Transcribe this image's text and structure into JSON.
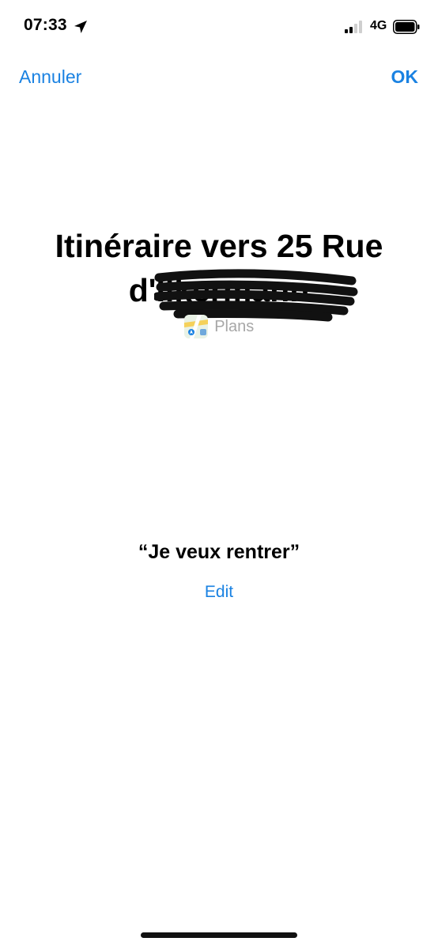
{
  "status_bar": {
    "time": "07:33",
    "network": "4G",
    "icons": [
      "location-arrow-icon",
      "signal-bars-icon",
      "battery-icon"
    ]
  },
  "nav": {
    "cancel_label": "Annuler",
    "ok_label": "OK"
  },
  "title": {
    "line1": "Itinéraire vers 25 Rue",
    "line2_visible": "d'Ilkermann"
  },
  "app": {
    "name": "Plans",
    "icon": "maps-app-icon"
  },
  "phrase": "“Je veux rentrer”",
  "edit_label": "Edit",
  "colors": {
    "accent": "#1a82e2",
    "secondary_text": "#a7a7a7",
    "background": "#ffffff"
  }
}
